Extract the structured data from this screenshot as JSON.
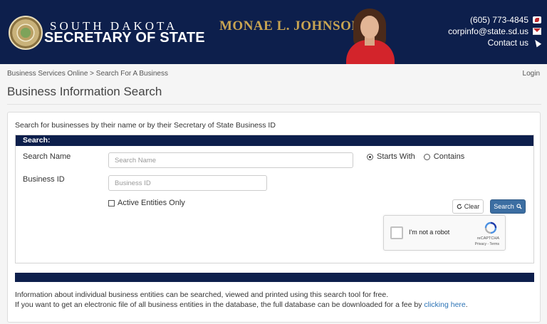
{
  "header": {
    "logo_line1": "SOUTH DAKOTA",
    "logo_line2": "SECRETARY OF STATE",
    "official_name": "MONAE L. JOHNSON",
    "contact": {
      "phone": "(605) 773-4845",
      "email": "corpinfo@state.sd.us",
      "contact_label": "Contact us"
    }
  },
  "breadcrumb": "Business Services Online > Search For A Business",
  "login_label": "Login",
  "page_title": "Business Information Search",
  "intro_text": "Search for businesses by their name or by their Secretary of State Business ID",
  "search_panel": {
    "heading": "Search:",
    "search_name_label": "Search Name",
    "search_name_placeholder": "Search Name",
    "search_name_value": "",
    "business_id_label": "Business ID",
    "business_id_placeholder": "Business ID",
    "business_id_value": "",
    "radio_starts_with": "Starts With",
    "radio_contains": "Contains",
    "selected_match": "Starts With",
    "active_only_label": "Active Entities Only",
    "active_only_checked": false,
    "clear_label": "Clear",
    "search_label": "Search"
  },
  "captcha": {
    "label": "I'm not a robot",
    "brand": "reCAPTCHA",
    "terms": "Privacy - Terms"
  },
  "footer_info": {
    "line1": "Information about individual business entities can be searched, viewed and printed using this search tool for free.",
    "line2_prefix": "If you want to get an electronic file of all business entities in the database, the full database can be downloaded for a fee by",
    "line2_link": "clicking here",
    "line2_suffix": "."
  },
  "colors": {
    "navy": "#0d1f4c",
    "gold": "#c8a452",
    "button_blue": "#3c6ea2",
    "link_blue": "#2a72b5"
  }
}
